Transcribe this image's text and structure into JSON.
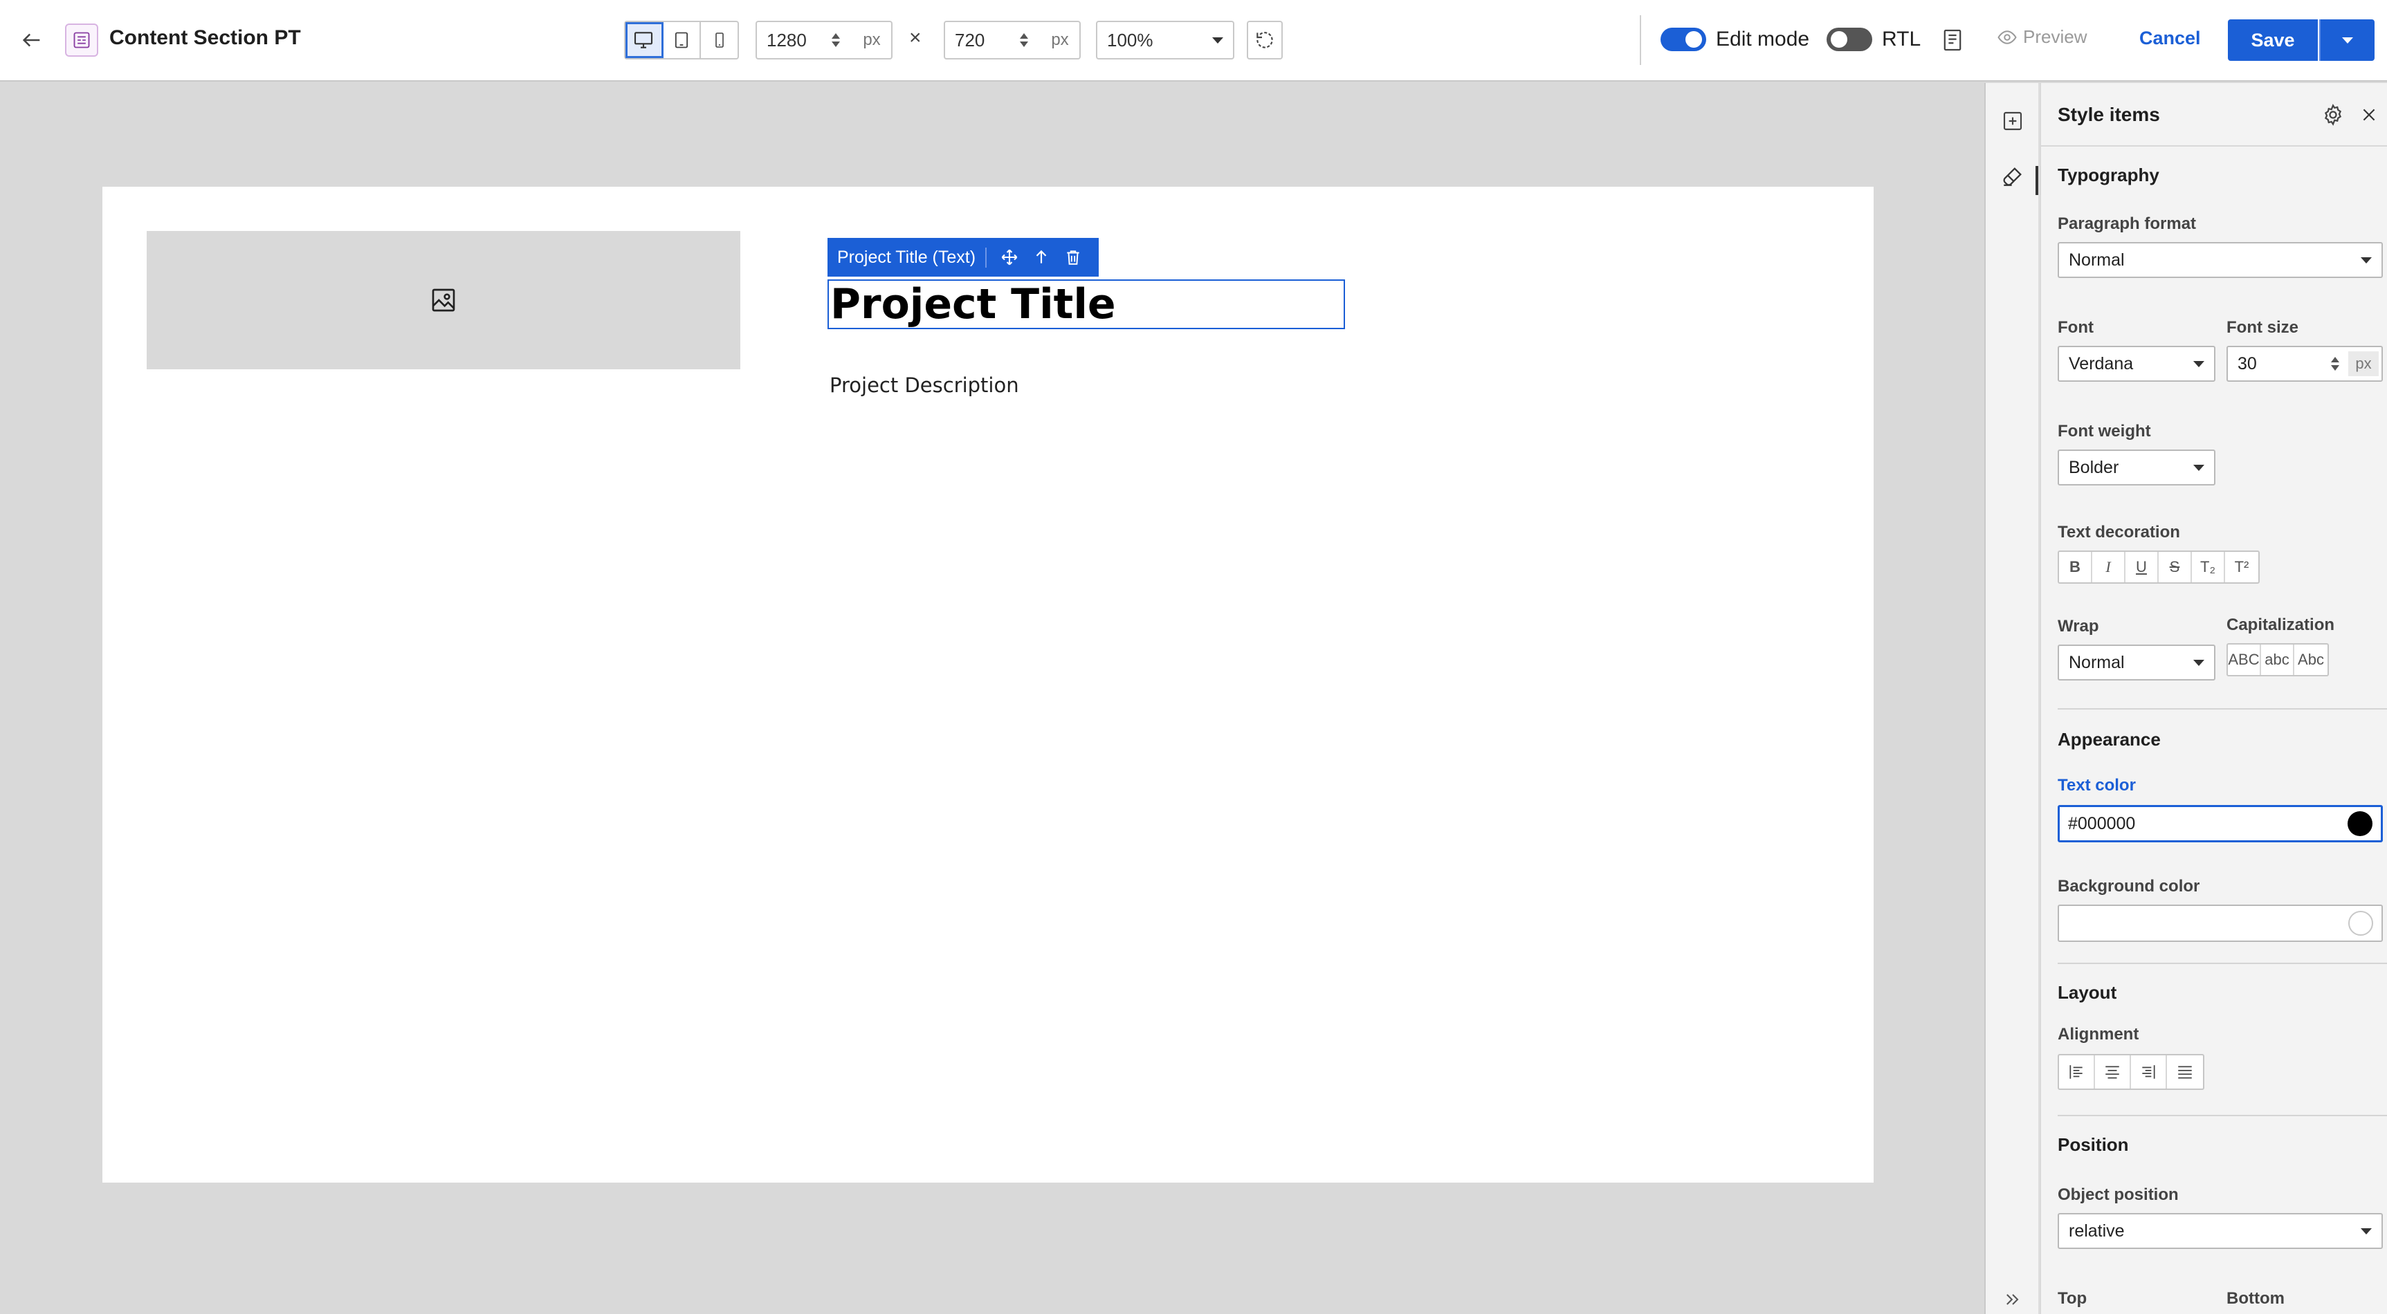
{
  "header": {
    "title": "Content Section PT",
    "width_value": "1280",
    "height_value": "720",
    "unit": "px",
    "times": "×",
    "zoom": "100%",
    "edit_mode_label": "Edit mode",
    "edit_mode_on": true,
    "rtl_label": "RTL",
    "rtl_on": false,
    "preview_label": "Preview",
    "cancel_label": "Cancel",
    "save_label": "Save"
  },
  "canvas": {
    "selection_label": "Project Title (Text)",
    "title_text": "Project Title",
    "description_text": "Project Description"
  },
  "panel": {
    "title": "Style items",
    "typography": {
      "heading": "Typography",
      "paragraph_format_label": "Paragraph format",
      "paragraph_format_value": "Normal",
      "font_label": "Font",
      "font_value": "Verdana",
      "font_size_label": "Font size",
      "font_size_value": "30",
      "font_size_unit": "px",
      "font_weight_label": "Font weight",
      "font_weight_value": "Bolder",
      "text_decoration_label": "Text decoration",
      "decorations": [
        "B",
        "I",
        "U",
        "S",
        "T₂",
        "T²"
      ],
      "wrap_label": "Wrap",
      "wrap_value": "Normal",
      "capitalization_label": "Capitalization",
      "capitalizations": [
        "ABC",
        "abc",
        "Abc"
      ]
    },
    "appearance": {
      "heading": "Appearance",
      "text_color_label": "Text color",
      "text_color_value": "#000000",
      "background_color_label": "Background color",
      "background_color_value": ""
    },
    "layout": {
      "heading": "Layout",
      "alignment_label": "Alignment"
    },
    "position": {
      "heading": "Position",
      "object_position_label": "Object position",
      "object_position_value": "relative",
      "top_label": "Top",
      "bottom_label": "Bottom"
    }
  },
  "colors": {
    "accent": "#1b5fd6",
    "canvas_bg": "#d9d9d9",
    "text_color_swatch": "#000000"
  },
  "icons": {
    "back": "arrow-left-icon",
    "app": "layout-icon",
    "desktop": "desktop-icon",
    "tablet": "tablet-icon",
    "mobile": "mobile-icon",
    "reset": "rotate-icon",
    "page": "document-icon",
    "preview": "eye-icon",
    "image": "image-icon",
    "move": "move-icon",
    "up": "arrow-up-icon",
    "delete": "trash-icon",
    "add": "plus-square-icon",
    "brush": "brush-icon",
    "settings": "gear-icon",
    "close": "close-icon",
    "expand": "double-chevron-right-icon"
  }
}
